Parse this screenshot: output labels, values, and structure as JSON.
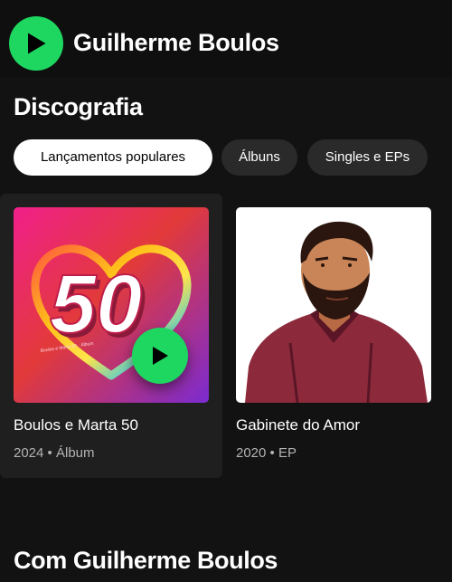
{
  "header": {
    "artist_name": "Guilherme Boulos",
    "play_icon": "play-icon",
    "accent_color": "#1ed760"
  },
  "discography": {
    "title": "Discografia",
    "filters": [
      {
        "label": "Lançamentos populares",
        "selected": true
      },
      {
        "label": "Álbuns",
        "selected": false
      },
      {
        "label": "Singles e EPs",
        "selected": false
      }
    ],
    "releases": [
      {
        "title": "Boulos e Marta 50",
        "year": "2024",
        "separator": "•",
        "type": "Álbum",
        "cover_text": "50",
        "cover_small_text": "Boulos e Marta 50 · Álbum"
      },
      {
        "title": "Gabinete do Amor",
        "year": "2020",
        "separator": "•",
        "type": "EP"
      }
    ]
  },
  "with_section": {
    "title": "Com Guilherme Boulos"
  }
}
